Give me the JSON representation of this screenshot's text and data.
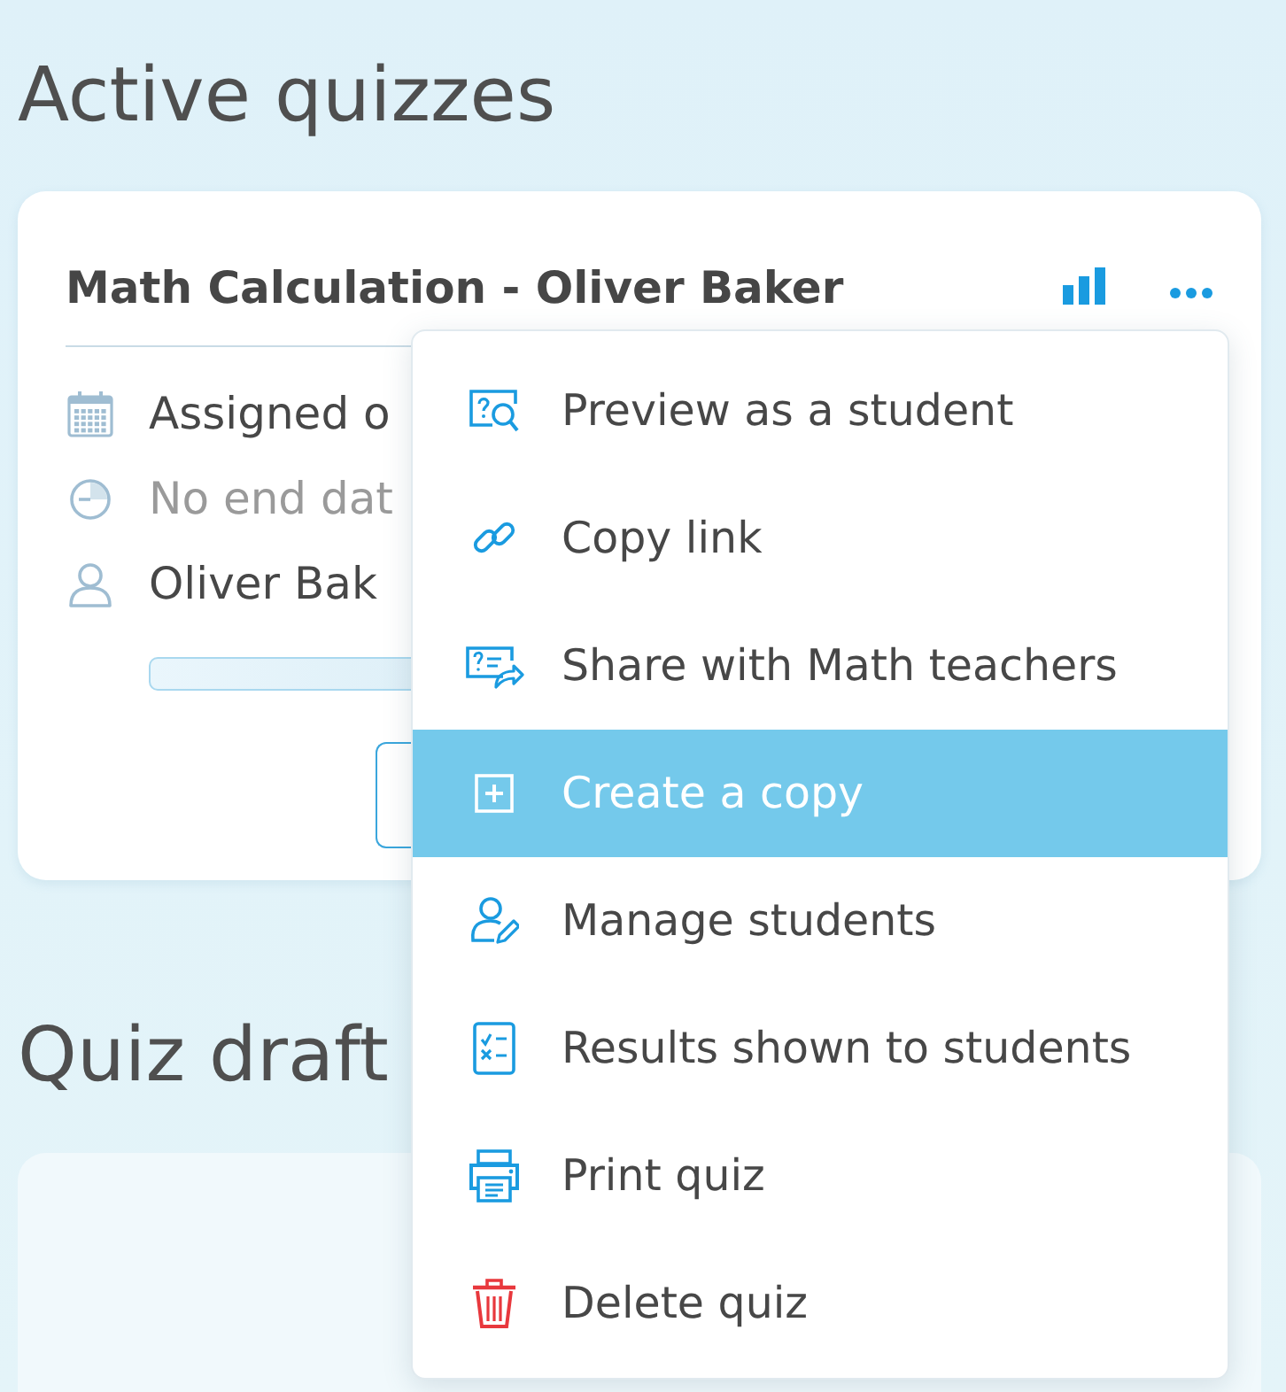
{
  "active_section": {
    "heading": "Active quizzes",
    "quiz_card": {
      "title": "Math Calculation - Oliver Baker",
      "details": [
        {
          "kind": "assigned",
          "text": "Assigned o"
        },
        {
          "kind": "deadline",
          "text": "No end dat"
        },
        {
          "kind": "student",
          "text": "Oliver Bak"
        }
      ]
    }
  },
  "context_menu": {
    "items": [
      {
        "label": "Preview as a student",
        "selected": false
      },
      {
        "label": "Copy link",
        "selected": false
      },
      {
        "label": "Share with Math teachers",
        "selected": false
      },
      {
        "label": "Create a copy",
        "selected": true
      },
      {
        "label": "Manage students",
        "selected": false
      },
      {
        "label": "Results shown to students",
        "selected": false
      },
      {
        "label": "Print quiz",
        "selected": false
      },
      {
        "label": "Delete quiz",
        "selected": false
      }
    ]
  },
  "drafts_section": {
    "heading": "Quiz draft"
  }
}
